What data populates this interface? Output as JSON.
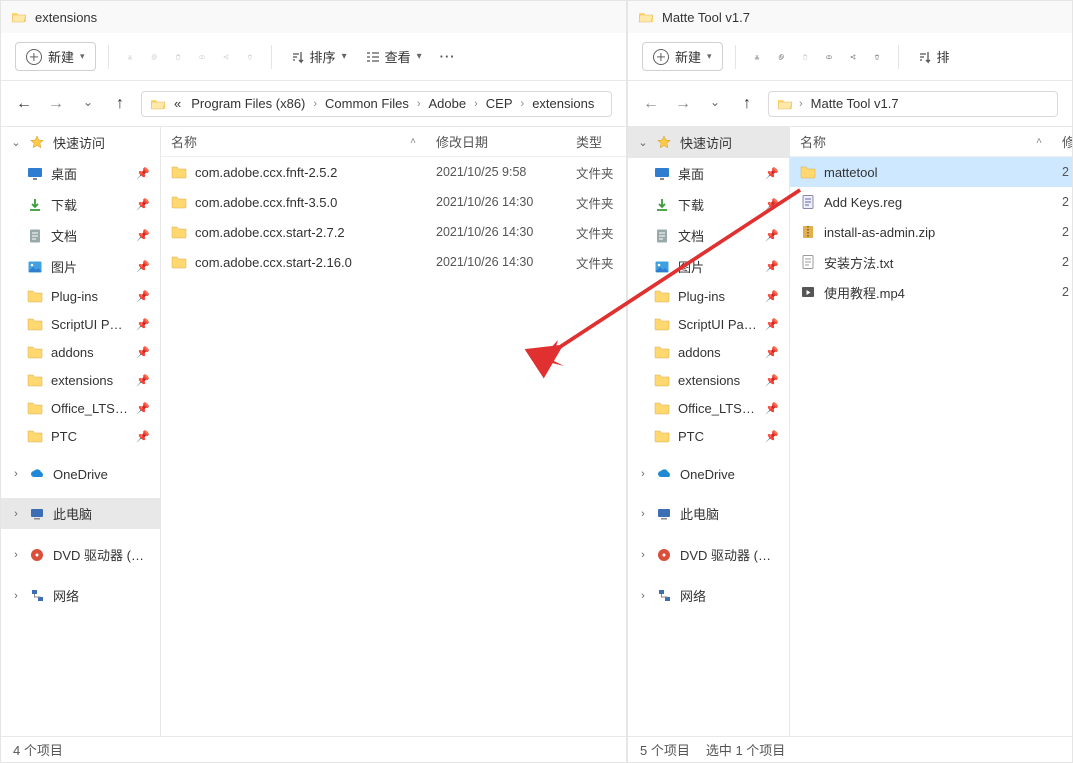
{
  "left": {
    "title": "extensions",
    "new_btn": "新建",
    "sort_label": "排序",
    "view_label": "查看",
    "breadcrumb": [
      "«",
      "Program Files (x86)",
      "Common Files",
      "Adobe",
      "CEP",
      "extensions"
    ],
    "columns": {
      "name": "名称",
      "date": "修改日期",
      "type": "类型"
    },
    "sidebar": {
      "quick": "快速访问",
      "items": [
        {
          "label": "桌面",
          "icon": "desktop"
        },
        {
          "label": "下载",
          "icon": "download"
        },
        {
          "label": "文档",
          "icon": "document"
        },
        {
          "label": "图片",
          "icon": "picture"
        },
        {
          "label": "Plug-ins",
          "icon": "folder"
        },
        {
          "label": "ScriptUI Panel",
          "icon": "folder"
        },
        {
          "label": "addons",
          "icon": "folder"
        },
        {
          "label": "extensions",
          "icon": "folder"
        },
        {
          "label": "Office_LTSC_ProP",
          "icon": "folder"
        },
        {
          "label": "PTC",
          "icon": "folder"
        }
      ],
      "onedrive": "OneDrive",
      "thispc": "此电脑",
      "dvd": "DVD 驱动器 (E:) Of",
      "network": "网络"
    },
    "rows": [
      {
        "name": "com.adobe.ccx.fnft-2.5.2",
        "date": "2021/10/25 9:58",
        "type": "文件夹"
      },
      {
        "name": "com.adobe.ccx.fnft-3.5.0",
        "date": "2021/10/26 14:30",
        "type": "文件夹"
      },
      {
        "name": "com.adobe.ccx.start-2.7.2",
        "date": "2021/10/26 14:30",
        "type": "文件夹"
      },
      {
        "name": "com.adobe.ccx.start-2.16.0",
        "date": "2021/10/26 14:30",
        "type": "文件夹"
      }
    ],
    "status": "4 个项目"
  },
  "right": {
    "title": "Matte Tool v1.7",
    "new_btn": "新建",
    "sort_hidden_label": "排",
    "breadcrumb": [
      "Matte Tool v1.7"
    ],
    "columns": {
      "name": "名称",
      "date": "修"
    },
    "sidebar": {
      "quick": "快速访问",
      "items": [
        {
          "label": "桌面",
          "icon": "desktop"
        },
        {
          "label": "下载",
          "icon": "download"
        },
        {
          "label": "文档",
          "icon": "document"
        },
        {
          "label": "图片",
          "icon": "picture"
        },
        {
          "label": "Plug-ins",
          "icon": "folder"
        },
        {
          "label": "ScriptUI Panel",
          "icon": "folder"
        },
        {
          "label": "addons",
          "icon": "folder"
        },
        {
          "label": "extensions",
          "icon": "folder"
        },
        {
          "label": "Office_LTSC_ProP",
          "icon": "folder"
        },
        {
          "label": "PTC",
          "icon": "folder"
        }
      ],
      "onedrive": "OneDrive",
      "thispc": "此电脑",
      "dvd": "DVD 驱动器 (E:) Of",
      "network": "网络"
    },
    "rows": [
      {
        "name": "mattetool",
        "icon": "folder",
        "date": "2",
        "selected": true
      },
      {
        "name": "Add Keys.reg",
        "icon": "reg",
        "date": "2"
      },
      {
        "name": "install-as-admin.zip",
        "icon": "zip",
        "date": "2"
      },
      {
        "name": "安装方法.txt",
        "icon": "txt",
        "date": "2"
      },
      {
        "name": "使用教程.mp4",
        "icon": "mp4",
        "date": "2"
      }
    ],
    "status_a": "5 个项目",
    "status_b": "选中 1 个项目"
  }
}
